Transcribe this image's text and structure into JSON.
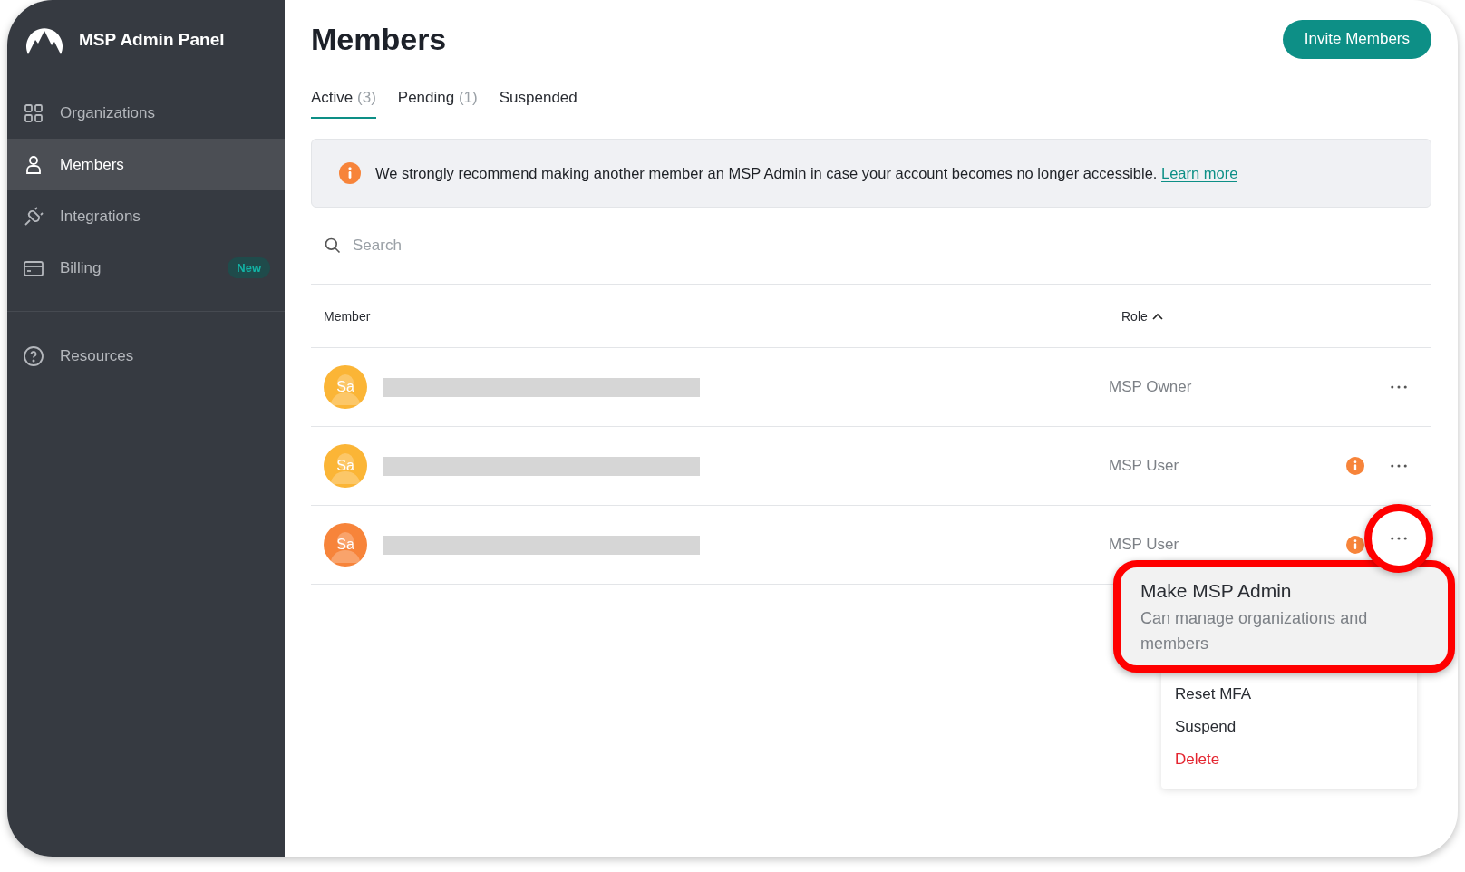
{
  "sidebar": {
    "title": "MSP Admin Panel",
    "items": [
      {
        "label": "Organizations",
        "kind": "grid",
        "selected": false
      },
      {
        "label": "Members",
        "kind": "person",
        "selected": true
      },
      {
        "label": "Integrations",
        "kind": "plug",
        "selected": false
      },
      {
        "label": "Billing",
        "kind": "card",
        "selected": false,
        "badge": "New"
      }
    ],
    "footer_items": [
      {
        "label": "Resources",
        "kind": "help",
        "selected": false
      }
    ]
  },
  "page": {
    "title": "Members",
    "invite_button": "Invite Members"
  },
  "tabs": [
    {
      "label": "Active",
      "count": "(3)",
      "selected": true
    },
    {
      "label": "Pending",
      "count": "(1)",
      "selected": false
    },
    {
      "label": "Suspended",
      "selected": false
    }
  ],
  "banner": {
    "text": "We strongly recommend making another member an MSP Admin in case your account becomes no longer accessible.",
    "link": "Learn more"
  },
  "search": {
    "placeholder": "Search"
  },
  "table": {
    "columns": [
      "Member",
      "Role"
    ],
    "rows": [
      {
        "initials": "Sa",
        "color": "#fbb536",
        "role": "MSP Owner",
        "warning": false,
        "menu_open": false
      },
      {
        "initials": "Sa",
        "color": "#fbb536",
        "role": "MSP User",
        "warning": true,
        "menu_open": false
      },
      {
        "initials": "Sa",
        "color": "#f7843a",
        "role": "MSP User",
        "warning": true,
        "menu_open": true
      }
    ]
  },
  "menu": {
    "items": [
      {
        "label": "Make MSP Admin",
        "description": "Can manage organizations and members",
        "kind": "highlighted"
      },
      {
        "label": "Reset MFA",
        "kind": "normal"
      },
      {
        "label": "Suspend",
        "kind": "normal"
      },
      {
        "label": "Delete",
        "kind": "danger"
      }
    ]
  }
}
